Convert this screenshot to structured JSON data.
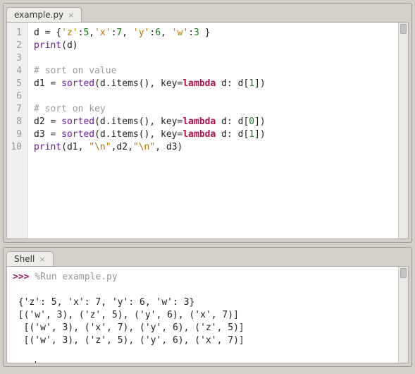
{
  "editor": {
    "tab_label": "example.py",
    "lines": [
      {
        "n": "1",
        "tokens": [
          {
            "t": "d ",
            "c": ""
          },
          {
            "t": "=",
            "c": "tok-op"
          },
          {
            "t": " {",
            "c": ""
          },
          {
            "t": "'z'",
            "c": "tok-str"
          },
          {
            "t": ":",
            "c": ""
          },
          {
            "t": "5",
            "c": "tok-num"
          },
          {
            "t": ",",
            "c": ""
          },
          {
            "t": "'x'",
            "c": "tok-str"
          },
          {
            "t": ":",
            "c": ""
          },
          {
            "t": "7",
            "c": "tok-num"
          },
          {
            "t": ", ",
            "c": ""
          },
          {
            "t": "'y'",
            "c": "tok-str"
          },
          {
            "t": ":",
            "c": ""
          },
          {
            "t": "6",
            "c": "tok-num"
          },
          {
            "t": ", ",
            "c": ""
          },
          {
            "t": "'w'",
            "c": "tok-str"
          },
          {
            "t": ":",
            "c": ""
          },
          {
            "t": "3",
            "c": "tok-num"
          },
          {
            "t": " }",
            "c": ""
          }
        ]
      },
      {
        "n": "2",
        "tokens": [
          {
            "t": "print",
            "c": "tok-fn"
          },
          {
            "t": "(d)",
            "c": ""
          }
        ]
      },
      {
        "n": "3",
        "tokens": []
      },
      {
        "n": "4",
        "tokens": [
          {
            "t": "# sort on value",
            "c": "tok-com"
          }
        ]
      },
      {
        "n": "5",
        "tokens": [
          {
            "t": "d1 ",
            "c": ""
          },
          {
            "t": "=",
            "c": "tok-op"
          },
          {
            "t": " ",
            "c": ""
          },
          {
            "t": "sorted",
            "c": "tok-fn"
          },
          {
            "t": "(d.items(), key",
            "c": ""
          },
          {
            "t": "=",
            "c": "tok-op"
          },
          {
            "t": "lambda",
            "c": "tok-kw"
          },
          {
            "t": " d: d[",
            "c": ""
          },
          {
            "t": "1",
            "c": "tok-num"
          },
          {
            "t": "])",
            "c": ""
          }
        ]
      },
      {
        "n": "6",
        "tokens": []
      },
      {
        "n": "7",
        "tokens": [
          {
            "t": "# sort on key",
            "c": "tok-com"
          }
        ]
      },
      {
        "n": "8",
        "tokens": [
          {
            "t": "d2 ",
            "c": ""
          },
          {
            "t": "=",
            "c": "tok-op"
          },
          {
            "t": " ",
            "c": ""
          },
          {
            "t": "sorted",
            "c": "tok-fn"
          },
          {
            "t": "(d.items(), key",
            "c": ""
          },
          {
            "t": "=",
            "c": "tok-op"
          },
          {
            "t": "lambda",
            "c": "tok-kw"
          },
          {
            "t": " d: d[",
            "c": ""
          },
          {
            "t": "0",
            "c": "tok-num"
          },
          {
            "t": "])",
            "c": ""
          }
        ]
      },
      {
        "n": "9",
        "tokens": [
          {
            "t": "d3 ",
            "c": ""
          },
          {
            "t": "=",
            "c": "tok-op"
          },
          {
            "t": " ",
            "c": ""
          },
          {
            "t": "sorted",
            "c": "tok-fn"
          },
          {
            "t": "(d.items(), key",
            "c": ""
          },
          {
            "t": "=",
            "c": "tok-op"
          },
          {
            "t": "lambda",
            "c": "tok-kw"
          },
          {
            "t": " d: d[",
            "c": ""
          },
          {
            "t": "1",
            "c": "tok-num"
          },
          {
            "t": "])",
            "c": ""
          }
        ]
      },
      {
        "n": "10",
        "tokens": [
          {
            "t": "print",
            "c": "tok-fn"
          },
          {
            "t": "(d1, ",
            "c": ""
          },
          {
            "t": "\"\\n\"",
            "c": "tok-str"
          },
          {
            "t": ",d2,",
            "c": ""
          },
          {
            "t": "\"\\n\"",
            "c": "tok-str"
          },
          {
            "t": ", d3)",
            "c": ""
          }
        ]
      }
    ]
  },
  "shell": {
    "tab_label": "Shell",
    "lines": [
      {
        "prompt": ">>> ",
        "runcmd": "%Run example.py"
      },
      {
        "text": ""
      },
      {
        "text": " {'z': 5, 'x': 7, 'y': 6, 'w': 3}"
      },
      {
        "text": " [('w', 3), ('z', 5), ('y', 6), ('x', 7)] "
      },
      {
        "text": "  [('w', 3), ('x', 7), ('y', 6), ('z', 5)] "
      },
      {
        "text": "  [('w', 3), ('z', 5), ('y', 6), ('x', 7)]"
      },
      {
        "text": ""
      },
      {
        "prompt": ">>> ",
        "cursor": true
      }
    ]
  }
}
